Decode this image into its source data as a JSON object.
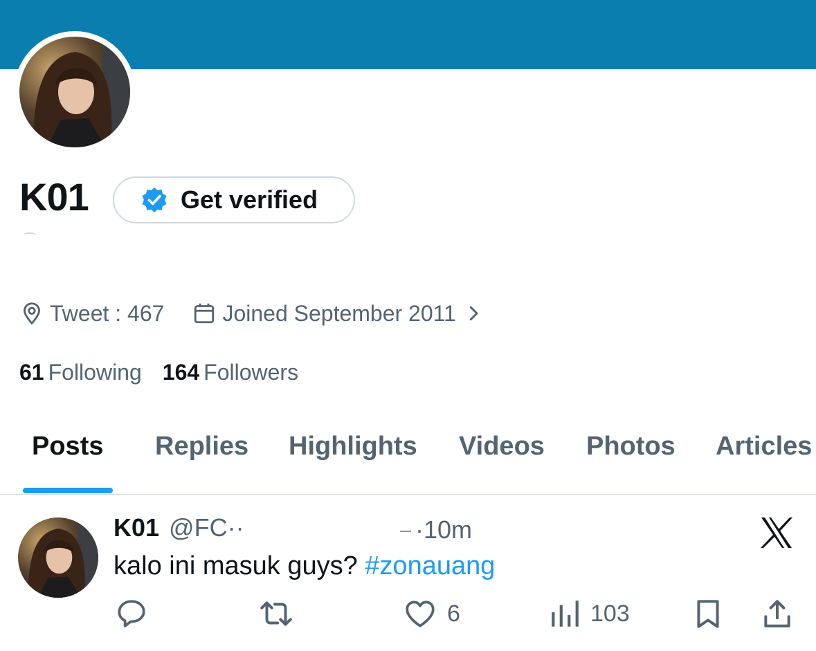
{
  "profile": {
    "name": "K01",
    "get_verified_label": "Get verified",
    "location_text": "Tweet : 467",
    "joined_text": "Joined September 2011",
    "following_count": "61",
    "following_label": "Following",
    "followers_count": "164",
    "followers_label": "Followers"
  },
  "tabs": [
    "Posts",
    "Replies",
    "Highlights",
    "Videos",
    "Photos",
    "Articles"
  ],
  "active_tab": "Posts",
  "tweet": {
    "name": "K01",
    "handle": "@FC··",
    "time": "·10m",
    "text": "kalo ini masuk guys? ",
    "hashtag": "#zonauang",
    "likes": "6",
    "views": "103"
  },
  "colors": {
    "banner": "#0a7eaf",
    "accent": "#1d9bf0",
    "muted_text": "#536471",
    "verified_badge": "#1d9bf0"
  },
  "icons": {
    "location": "location-pin-icon",
    "calendar": "calendar-icon",
    "chevron": "chevron-right-icon",
    "verified": "verified-badge-icon",
    "reply": "reply-icon",
    "retweet": "retweet-icon",
    "like": "heart-icon",
    "views": "views-icon",
    "bookmark": "bookmark-icon",
    "share": "share-icon",
    "x_logo": "x-logo-icon"
  }
}
